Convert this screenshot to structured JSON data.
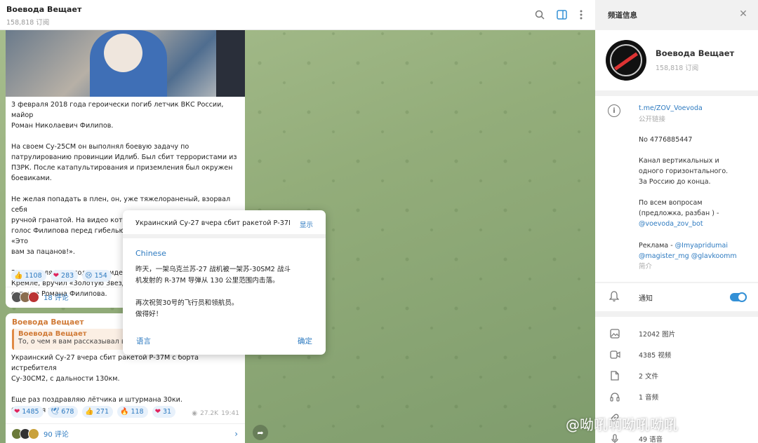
{
  "chat": {
    "title": "Воевода Вещает",
    "subscribers": "158,818 订阅",
    "icons": [
      "search-icon",
      "sidebar-toggle-icon",
      "more-icon"
    ]
  },
  "message1": {
    "text": "3 февраля 2018 года героически погиб летчик ВКС России, майор\nРоман Николаевич Филипов.\n\nНа своем Су-25СМ он выполнял боевую задачу по\nпатрулированию провинции Идлиб. Был сбит террористами из\nПЗРК. После катапультирования и приземления был окружен\nбоевиками.\n\nНе желая попадать в плен, он, уже тяжелораненый, взорвал себя\nручной гранатой. На видео которое снимали боевики слышен\nголос Филипова перед гибелью, его последние слова были: «Это\nвам за пацанов!».\n\n23 февраля 2018 года Президент\nКремле, вручил «Золотую Звезд\nсупруге Романа Филипова.",
    "reactions": [
      {
        "emoji": "👍",
        "count": "1108"
      },
      {
        "emoji": "❤",
        "count": "283"
      },
      {
        "emoji": "😢",
        "count": "154"
      }
    ],
    "comments": "18 评论"
  },
  "message2": {
    "author": "Воевода Вещает",
    "quote_author": "Воевода Вещает",
    "quote_text": "То, о чем я вам рассказывал вчера",
    "text": "Украинский Су-27 вчера сбит ракетой Р-37М с борта истребителя\nСу-30СМ2, с дальности 130км.\n\nЕще раз поздравляю лётчика и штурмана 30ки.\nОтличная работа!",
    "reactions": [
      {
        "emoji": "❤",
        "count": "1485"
      },
      {
        "emoji": "🕊",
        "count": "678"
      },
      {
        "emoji": "👍",
        "count": "271"
      },
      {
        "emoji": "🔥",
        "count": "118"
      },
      {
        "emoji": "❤",
        "count": "31"
      }
    ],
    "views": "27.2K",
    "time": "19:41",
    "comments": "90 评论"
  },
  "dialog": {
    "original": "Украинский Су-27 вчера сбит ракетой Р-37М",
    "show_label": "显示",
    "language": "Chinese",
    "translation": "昨天，一架乌克兰苏-27 战机被一架苏-30SM2 战斗\n机发射的 R-37M 导弹从 130 公里范围内击落。\n\n再次祝贺30号的飞行员和领航员。\n做得好！",
    "language_button": "语言",
    "ok_button": "确定"
  },
  "panel": {
    "title": "频道信息",
    "channel_name": "Воевода Вещает",
    "subscribers": "158,818 订阅",
    "link": "t.me/ZOV_Voevoda",
    "link_caption": "公开链接",
    "number": "No 4776885447",
    "description": "Канал вертикальных и\nодного горизонтального.\nЗа Россию до конца.",
    "questions_text": "По всем вопросам\n(предложка, разбан ) -",
    "questions_link": "@voevoda_zov_bot",
    "ads_text": "Реклама - ",
    "ads_link1": "@Imyapridumai",
    "ads_link2": "@magister_mg @glavkoomm",
    "desc_caption": "简介",
    "notifications": "通知",
    "notifications_on": true,
    "media": [
      {
        "icon": "photo-icon",
        "label": "12042 图片"
      },
      {
        "icon": "video-icon",
        "label": "4385 视频"
      },
      {
        "icon": "file-icon",
        "label": "2 文件"
      },
      {
        "icon": "audio-icon",
        "label": "1 音频"
      },
      {
        "icon": "link-icon",
        "label": ""
      },
      {
        "icon": "voice-icon",
        "label": "49 语音"
      }
    ]
  },
  "watermark": "@呦吼啊呦吼呦吼",
  "colors": {
    "accent": "#2d7ac0",
    "author": "#d07a36",
    "toggle": "#3390d6"
  }
}
